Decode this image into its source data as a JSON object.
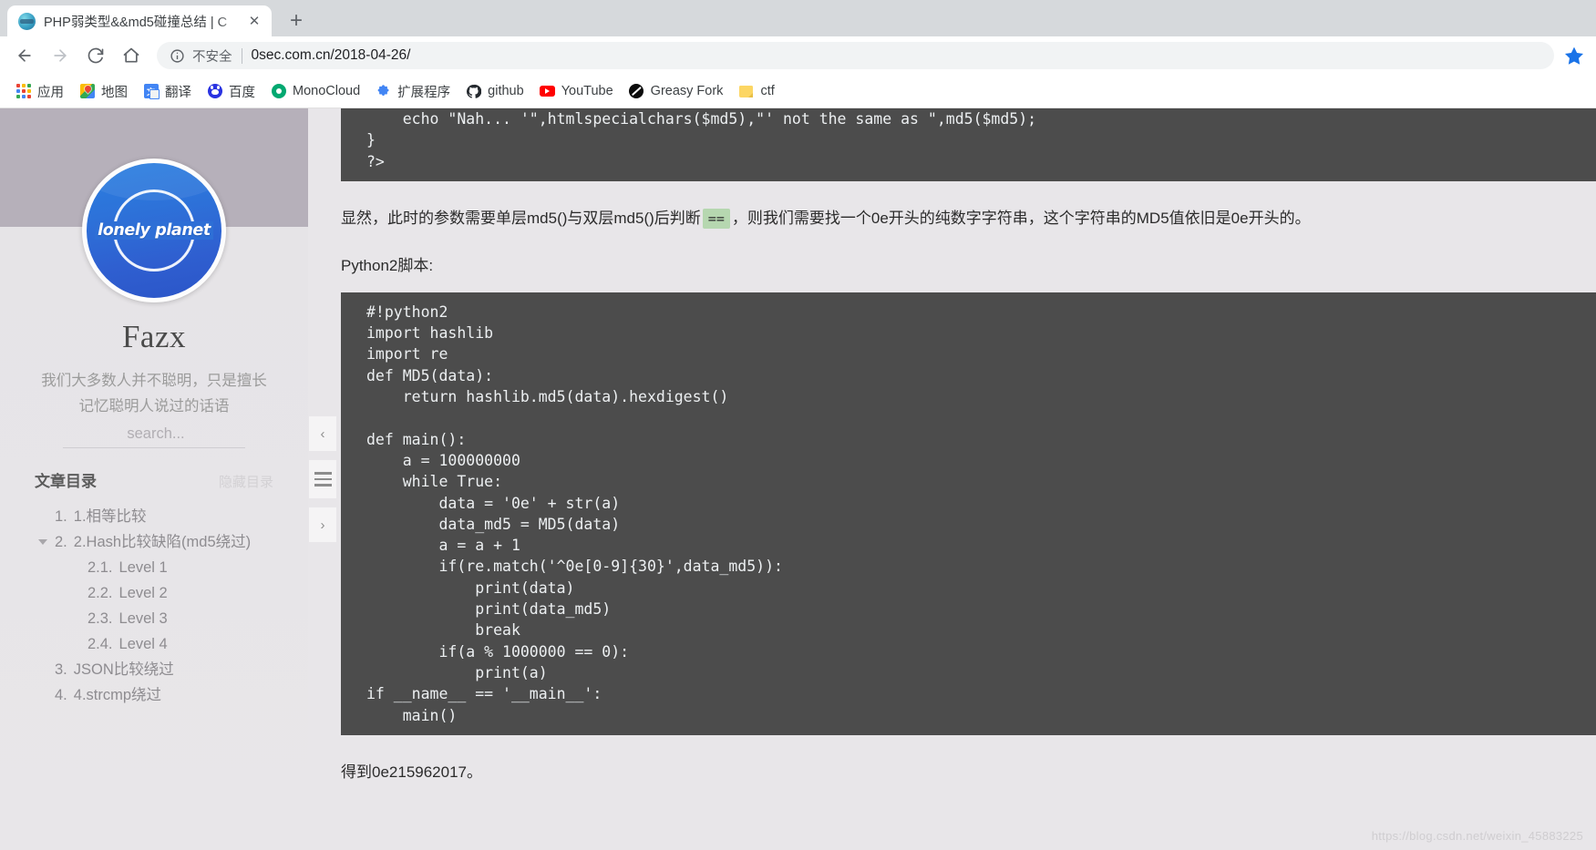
{
  "browser": {
    "tab": {
      "title": "PHP弱类型&&md5碰撞总结 | C",
      "favicon": "globe-favicon",
      "close_label": "✕"
    },
    "newtab_label": "+",
    "toolbar": {
      "back_label": "←",
      "forward_label": "→",
      "reload_label": "↻",
      "home_label": "⌂",
      "security_text": "不安全",
      "url": "0sec.com.cn/2018-04-26/",
      "bookmark_star": "star-icon"
    },
    "bookmarks": [
      {
        "label": "应用",
        "icon": "apps-grid-icon"
      },
      {
        "label": "地图",
        "icon": "google-maps-icon"
      },
      {
        "label": "翻译",
        "icon": "google-translate-icon"
      },
      {
        "label": "百度",
        "icon": "baidu-icon"
      },
      {
        "label": "MonoCloud",
        "icon": "monocloud-icon"
      },
      {
        "label": "扩展程序",
        "icon": "puzzle-extension-icon"
      },
      {
        "label": "github",
        "icon": "github-icon"
      },
      {
        "label": "YouTube",
        "icon": "youtube-icon"
      },
      {
        "label": "Greasy Fork",
        "icon": "greasy-fork-icon"
      },
      {
        "label": "ctf",
        "icon": "folder-icon"
      }
    ]
  },
  "sidebar": {
    "avatar_text": "lonely planet",
    "author": "Fazx",
    "motto": "我们大多数人并不聪明，只是擅长记忆聪明人说过的话语",
    "search_placeholder": "search...",
    "search_value": "",
    "toc_title": "文章目录",
    "toc_toggle": "隐藏目录",
    "toc": [
      {
        "num": "1.",
        "label": "1.相等比较",
        "caret": false
      },
      {
        "num": "2.",
        "label": "2.Hash比较缺陷(md5绕过)",
        "caret": true
      },
      {
        "num": "3.",
        "label": "JSON比较绕过",
        "caret": false
      },
      {
        "num": "4.",
        "label": "4.strcmp绕过",
        "caret": false
      }
    ],
    "toc_sub": [
      {
        "num": "2.1.",
        "label": "Level 1"
      },
      {
        "num": "2.2.",
        "label": "Level 2"
      },
      {
        "num": "2.3.",
        "label": "Level 3"
      },
      {
        "num": "2.4.",
        "label": "Level 4"
      }
    ],
    "handles": {
      "collapse": "‹",
      "expand": "›"
    }
  },
  "article": {
    "php_code_tail": "    echo \"Nah... '\",htmlspecialchars($md5),\"' not the same as \",md5($md5);\n}\n?>",
    "paragraph_1_before": "显然，此时的参数需要单层md5()与双层md5()后判断",
    "paragraph_1_code": "==",
    "paragraph_1_after": "，则我们需要找一个0e开头的纯数字字符串，这个字符串的MD5值依旧是0e开头的。",
    "paragraph_2": "Python2脚本:",
    "python_code": "#!python2\nimport hashlib\nimport re\ndef MD5(data):\n    return hashlib.md5(data).hexdigest()\n\ndef main():\n    a = 100000000\n    while True:\n        data = '0e' + str(a)\n        data_md5 = MD5(data)\n        a = a + 1\n        if(re.match('^0e[0-9]{30}',data_md5)):\n            print(data)\n            print(data_md5)\n            break\n        if(a % 1000000 == 0):\n            print(a)\nif __name__ == '__main__':\n    main()",
    "paragraph_3": "得到0e215962017。",
    "watermark": "https://blog.csdn.net/weixin_45883225"
  },
  "colors": {
    "code_bg": "#4c4c4c",
    "inline_code_bg": "#b6d7b0",
    "accent": "#1a73e8",
    "page_bg": "#e8e6e9"
  }
}
